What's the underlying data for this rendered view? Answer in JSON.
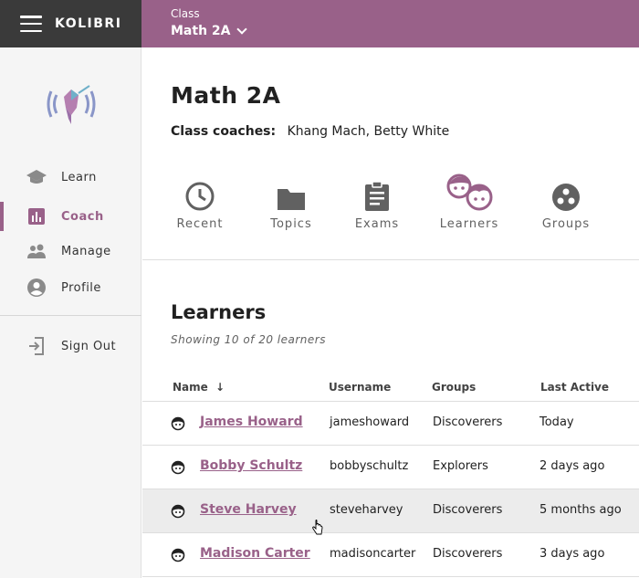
{
  "app": {
    "brand": "KOLIBRI"
  },
  "topbar": {
    "class_caption": "Class",
    "class_name": "Math 2A"
  },
  "sidebar": {
    "items": [
      {
        "label": "Learn",
        "icon": "learn-icon"
      },
      {
        "label": "Coach",
        "icon": "coach-icon",
        "active": true
      },
      {
        "label": "Manage",
        "icon": "manage-icon"
      },
      {
        "label": "Profile",
        "icon": "profile-icon"
      },
      {
        "label": "Sign Out",
        "icon": "sign-out-icon"
      }
    ]
  },
  "main": {
    "title": "Math 2A",
    "coaches_label": "Class coaches:",
    "coaches_value": "Khang Mach, Betty White",
    "tabs": [
      {
        "label": "Recent",
        "icon": "clock-icon"
      },
      {
        "label": "Topics",
        "icon": "folder-icon"
      },
      {
        "label": "Exams",
        "icon": "clipboard-icon"
      },
      {
        "label": "Learners",
        "icon": "learners-icon",
        "active": true
      },
      {
        "label": "Groups",
        "icon": "groups-icon"
      }
    ],
    "section_title": "Learners",
    "showing_text": "Showing 10 of 20 learners",
    "table": {
      "headers": {
        "name": "Name",
        "sort_arrow": "↓",
        "username": "Username",
        "groups": "Groups",
        "last_active": "Last Active"
      },
      "rows": [
        {
          "name": "James Howard",
          "username": "jameshoward",
          "group": "Discoverers",
          "last_active": "Today"
        },
        {
          "name": "Bobby Schultz",
          "username": "bobbyschultz",
          "group": "Explorers",
          "last_active": "2 days ago"
        },
        {
          "name": "Steve Harvey",
          "username": "steveharvey",
          "group": "Discoverers",
          "last_active": "5 months ago"
        },
        {
          "name": "Madison Carter",
          "username": "madisoncarter",
          "group": "Discoverers",
          "last_active": "3 days ago"
        }
      ]
    }
  },
  "colors": {
    "brand": "#996189",
    "topbar_left": "#3a3a3a",
    "sidebar_bg": "#f5f5f5"
  }
}
